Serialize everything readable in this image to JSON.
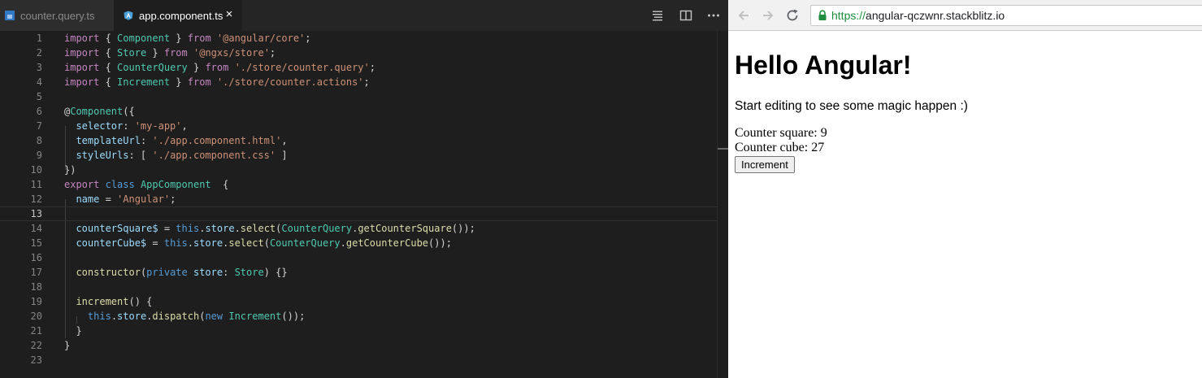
{
  "editor": {
    "tabs": [
      {
        "label": "counter.query.ts",
        "icon": "typescript-file-icon",
        "active": false
      },
      {
        "label": "app.component.ts",
        "icon": "angular-file-icon",
        "active": true
      }
    ],
    "toolbar": [
      "outline-icon",
      "split-editor-icon",
      "more-actions-icon"
    ],
    "current_line": 13,
    "line_numbers": [
      "1",
      "2",
      "3",
      "4",
      "5",
      "6",
      "7",
      "8",
      "9",
      "10",
      "11",
      "12",
      "13",
      "14",
      "15",
      "16",
      "17",
      "18",
      "19",
      "20",
      "21",
      "22",
      "23"
    ],
    "code": [
      [
        [
          "kw",
          "import"
        ],
        [
          "pl",
          " { "
        ],
        [
          "ty",
          "Component"
        ],
        [
          "pl",
          " } "
        ],
        [
          "kw",
          "from"
        ],
        [
          "pl",
          " "
        ],
        [
          "st",
          "'@angular/core'"
        ],
        [
          "pl",
          ";"
        ]
      ],
      [
        [
          "kw",
          "import"
        ],
        [
          "pl",
          " { "
        ],
        [
          "ty",
          "Store"
        ],
        [
          "pl",
          " } "
        ],
        [
          "kw",
          "from"
        ],
        [
          "pl",
          " "
        ],
        [
          "st",
          "'@ngxs/store'"
        ],
        [
          "pl",
          ";"
        ]
      ],
      [
        [
          "kw",
          "import"
        ],
        [
          "pl",
          " { "
        ],
        [
          "ty",
          "CounterQuery"
        ],
        [
          "pl",
          " } "
        ],
        [
          "kw",
          "from"
        ],
        [
          "pl",
          " "
        ],
        [
          "st",
          "'./store/counter.query'"
        ],
        [
          "pl",
          ";"
        ]
      ],
      [
        [
          "kw",
          "import"
        ],
        [
          "pl",
          " { "
        ],
        [
          "ty",
          "Increment"
        ],
        [
          "pl",
          " } "
        ],
        [
          "kw",
          "from"
        ],
        [
          "pl",
          " "
        ],
        [
          "st",
          "'./store/counter.actions'"
        ],
        [
          "pl",
          ";"
        ]
      ],
      [],
      [
        [
          "pl",
          "@"
        ],
        [
          "ty",
          "Component"
        ],
        [
          "pl",
          "({"
        ]
      ],
      [
        [
          "pl",
          "  "
        ],
        [
          "pr",
          "selector"
        ],
        [
          "pl",
          ": "
        ],
        [
          "st",
          "'my-app'"
        ],
        [
          "pl",
          ","
        ]
      ],
      [
        [
          "pl",
          "  "
        ],
        [
          "pr",
          "templateUrl"
        ],
        [
          "pl",
          ": "
        ],
        [
          "st",
          "'./app.component.html'"
        ],
        [
          "pl",
          ","
        ]
      ],
      [
        [
          "pl",
          "  "
        ],
        [
          "pr",
          "styleUrls"
        ],
        [
          "pl",
          ": [ "
        ],
        [
          "st",
          "'./app.component.css'"
        ],
        [
          "pl",
          " ]"
        ]
      ],
      [
        [
          "pl",
          "})"
        ]
      ],
      [
        [
          "kw",
          "export"
        ],
        [
          "pl",
          " "
        ],
        [
          "kb",
          "class"
        ],
        [
          "pl",
          " "
        ],
        [
          "ty",
          "AppComponent"
        ],
        [
          "pl",
          "  {"
        ]
      ],
      [
        [
          "pl",
          "  "
        ],
        [
          "pr",
          "name"
        ],
        [
          "pl",
          " = "
        ],
        [
          "st",
          "'Angular'"
        ],
        [
          "pl",
          ";"
        ]
      ],
      [],
      [
        [
          "pl",
          "  "
        ],
        [
          "pr",
          "counterSquare$"
        ],
        [
          "pl",
          " = "
        ],
        [
          "kb",
          "this"
        ],
        [
          "pl",
          "."
        ],
        [
          "pr",
          "store"
        ],
        [
          "pl",
          "."
        ],
        [
          "fn",
          "select"
        ],
        [
          "pl",
          "("
        ],
        [
          "ty",
          "CounterQuery"
        ],
        [
          "pl",
          "."
        ],
        [
          "fn",
          "getCounterSquare"
        ],
        [
          "pl",
          "());"
        ]
      ],
      [
        [
          "pl",
          "  "
        ],
        [
          "pr",
          "counterCube$"
        ],
        [
          "pl",
          " = "
        ],
        [
          "kb",
          "this"
        ],
        [
          "pl",
          "."
        ],
        [
          "pr",
          "store"
        ],
        [
          "pl",
          "."
        ],
        [
          "fn",
          "select"
        ],
        [
          "pl",
          "("
        ],
        [
          "ty",
          "CounterQuery"
        ],
        [
          "pl",
          "."
        ],
        [
          "fn",
          "getCounterCube"
        ],
        [
          "pl",
          "());"
        ]
      ],
      [],
      [
        [
          "pl",
          "  "
        ],
        [
          "fn",
          "constructor"
        ],
        [
          "pl",
          "("
        ],
        [
          "kb",
          "private"
        ],
        [
          "pl",
          " "
        ],
        [
          "pr",
          "store"
        ],
        [
          "pl",
          ": "
        ],
        [
          "ty",
          "Store"
        ],
        [
          "pl",
          ") {}"
        ]
      ],
      [],
      [
        [
          "pl",
          "  "
        ],
        [
          "fn",
          "increment"
        ],
        [
          "pl",
          "() {"
        ]
      ],
      [
        [
          "pl",
          "    "
        ],
        [
          "kb",
          "this"
        ],
        [
          "pl",
          "."
        ],
        [
          "pr",
          "store"
        ],
        [
          "pl",
          "."
        ],
        [
          "fn",
          "dispatch"
        ],
        [
          "pl",
          "("
        ],
        [
          "kb",
          "new"
        ],
        [
          "pl",
          " "
        ],
        [
          "ty",
          "Increment"
        ],
        [
          "pl",
          "());"
        ]
      ],
      [
        [
          "pl",
          "  }"
        ]
      ],
      [
        [
          "pl",
          "}"
        ]
      ],
      []
    ]
  },
  "browser": {
    "url_scheme": "https://",
    "url_host": "angular-qczwnr.stackblitz.io",
    "nav": [
      "back-icon",
      "forward-icon",
      "reload-icon"
    ],
    "page": {
      "heading": "Hello Angular!",
      "intro": "Start editing to see some magic happen :)",
      "counter_square": "Counter square: 9",
      "counter_cube": "Counter cube: 27",
      "button_label": "Increment"
    }
  },
  "colors": {
    "editor_bg": "#1e1e1e",
    "keyword": "#c586c0",
    "type": "#4ec9b0",
    "string": "#ce9178",
    "property": "#9cdcfe",
    "function": "#dcdcaa",
    "builtin": "#569cd6",
    "secure_url": "#1e8e3e"
  }
}
